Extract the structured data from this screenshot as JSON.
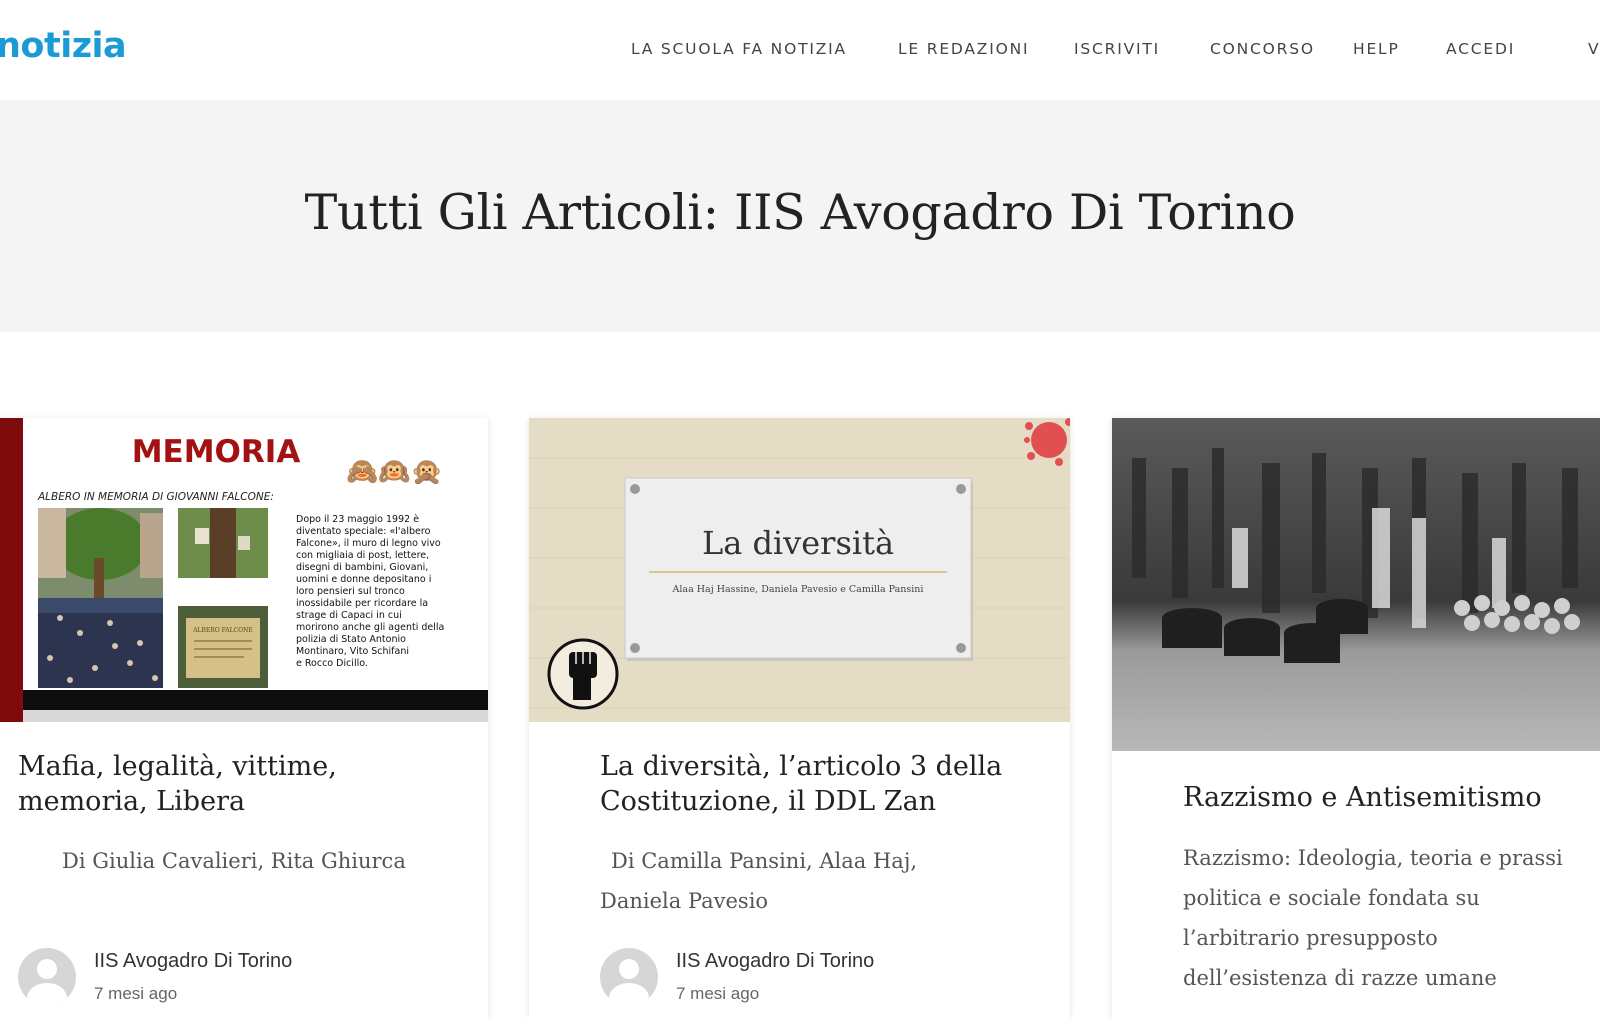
{
  "site": {
    "logo_text": "notizia"
  },
  "nav": {
    "items": [
      "LA SCUOLA FA NOTIZIA",
      "LE REDAZIONI",
      "ISCRIVITI",
      "CONCORSO",
      "HELP",
      "ACCEDI",
      "V"
    ]
  },
  "banner": {
    "title": "Tutti Gli Articoli: IIS Avogadro Di Torino"
  },
  "articles": [
    {
      "title": "Mafia, legalità, vittime, memoria, Libera",
      "byline": "Di Giulia Cavalieri, Rita Ghiurca",
      "author": "IIS Avogadro Di Torino",
      "date": "7 mesi ago",
      "image": {
        "heading": "MEMORIA",
        "subheading": "ALBERO IN MEMORIA DI GIOVANNI FALCONE:",
        "text_lines": [
          "Dopo il 23 maggio 1992 è",
          "diventato speciale: «l'albero",
          "Falcone», il muro di legno vivo",
          "con migliaia di post, lettere,",
          "disegni di bambini, Giovani,",
          "uomini e donne depositano i",
          "loro pensieri sul tronco",
          "inossidabile per ricordare la",
          "strage di Capaci in cui",
          "morirono anche gli agenti della",
          "polizia di Stato Antonio",
          "Montinaro, Vito Schifani",
          "e Rocco Dicillo."
        ],
        "monkeys": "🙈🙉🙊",
        "plaque": "ALBERO FALCONE"
      }
    },
    {
      "title": "La diversità, l’articolo 3 della Costituzione, il DDL Zan",
      "byline": "Di Camilla Pansini, Alaa Haj, Daniela Pavesio",
      "author": "IIS Avogadro Di Torino",
      "date": "7 mesi ago",
      "image": {
        "slide_title": "La diversità",
        "slide_subtitle": "Alaa Haj Hassine, Daniela Pavesio e Camilla Pansini"
      }
    },
    {
      "title": "Razzismo e Antisemitismo",
      "excerpt": "Razzismo: Ideologia, teoria e prassi politica e sociale fondata su l’arbitrario presupposto dell’esistenza di razze umane"
    }
  ]
}
